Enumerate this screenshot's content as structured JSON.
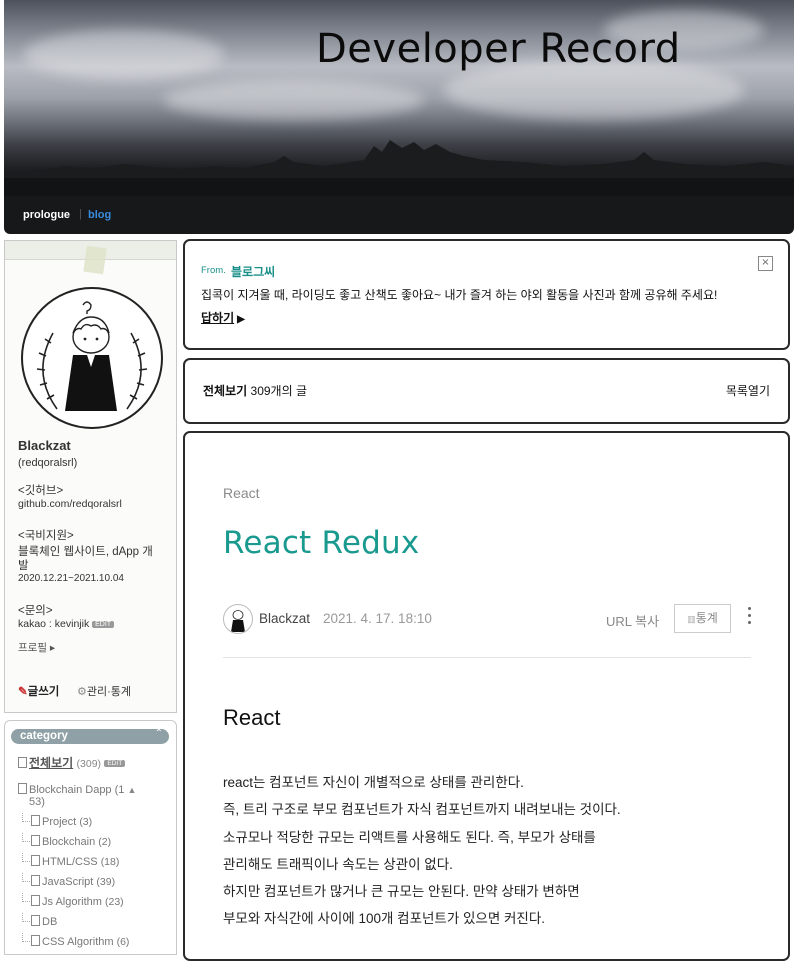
{
  "header": {
    "title": "Developer Record",
    "nav": {
      "prologue": "prologue",
      "separator": "|",
      "blog": "blog"
    }
  },
  "sidebar": {
    "profile": {
      "name": "Blackzat",
      "id": "(redqoralsrl)",
      "github_label": "<깃허브>",
      "github_url": "github.com/redqoralsrl",
      "training_label": "<국비지원>",
      "training_desc_1": "블록체인 웹사이트, dApp 개",
      "training_desc_2": "발",
      "training_period": "2020.12.21~2021.10.04",
      "contact_label": "<문의>",
      "contact_value": "kakao : kevinjik",
      "edit_badge": "EDIT",
      "profile_link": "프로필 ▸",
      "write_label": "글쓰기",
      "manage_label": "관리·통계"
    },
    "category": {
      "header": "category",
      "all_label": "전체보기",
      "all_count": "(309)",
      "edit_badge": "EDIT",
      "group_label": "Blockchain Dapp (1",
      "group_count_cont": "53)",
      "items": [
        {
          "label": "Project",
          "count": "(3)"
        },
        {
          "label": "Blockchain",
          "count": "(2)"
        },
        {
          "label": "HTML/CSS",
          "count": "(18)"
        },
        {
          "label": "JavaScript",
          "count": "(39)"
        },
        {
          "label": "Js Algorithm",
          "count": "(23)"
        },
        {
          "label": "DB",
          "count": ""
        },
        {
          "label": "CSS Algorithm",
          "count": "(6)"
        }
      ]
    }
  },
  "guestbook": {
    "from_label": "From.",
    "from_name": "블로그씨",
    "message": "집콕이 지겨울 때, 라이딩도 좋고 산책도 좋아요~ 내가 즐겨 하는 야외 활동을 사진과 함께 공유해 주세요!",
    "reply": "답하기",
    "close": "×"
  },
  "post_list": {
    "all_label": "전체보기",
    "count_text": "309개의 글",
    "open_label": "목록열기"
  },
  "post": {
    "category": "React",
    "title": "React Redux",
    "author": "Blackzat",
    "date": "2021. 4. 17. 18:10",
    "url_copy": "URL 복사",
    "stats": "통계",
    "heading": "React",
    "body": [
      "react는 컴포넌트 자신이 개별적으로 상태를 관리한다.",
      "즉, 트리 구조로 부모 컴포넌트가 자식 컴포넌트까지 내려보내는 것이다.",
      "소규모나 적당한 규모는 리액트를 사용해도 된다. 즉, 부모가 상태를",
      "관리해도 트래픽이나 속도는 상관이 없다.",
      "하지만 컴포넌트가 많거나 큰 규모는 안된다. 만약 상태가 변하면",
      "부모와 자식간에 사이에 100개 컴포넌트가 있으면 커진다."
    ]
  }
}
